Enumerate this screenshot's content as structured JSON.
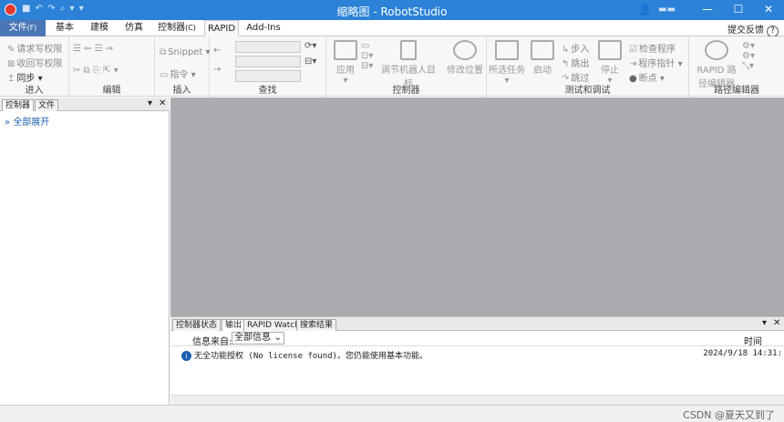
{
  "window": {
    "title": "缩略图 - RobotStudio",
    "user": "👤"
  },
  "tabs": [
    {
      "label": "文件",
      "key": "(F)"
    },
    {
      "label": "基本"
    },
    {
      "label": "建模"
    },
    {
      "label": "仿真"
    },
    {
      "label": "控制器",
      "key": "(C)"
    },
    {
      "label": "RAPID"
    },
    {
      "label": "Add-Ins"
    }
  ],
  "feedback": {
    "label": "提交反馈",
    "help": "?"
  },
  "ribbon": {
    "enter": {
      "label": "进入",
      "request": "请求写权限",
      "revoke": "收回写权限",
      "sync": "同步"
    },
    "edit": {
      "label": "编辑"
    },
    "insert": {
      "label": "插入",
      "snippet": "Snippet",
      "instruction": "指令"
    },
    "find": {
      "label": "查找"
    },
    "controller": {
      "label": "控制器",
      "apply": "应用",
      "adjust_targets": "调节机器人目标",
      "modify_position": "修改位置"
    },
    "test": {
      "label": "测试和调试",
      "select_tasks": "所选任务",
      "start": "启动",
      "step_in": "步入",
      "step_out": "跳出",
      "step_over": "跳过",
      "stop": "停止",
      "check_program": "检查程序",
      "program_pointer": "程序指针",
      "breakpoint": "断点"
    },
    "path": {
      "label": "路径编辑器",
      "rapid_path": "RAPID 路径编辑器"
    }
  },
  "left_panel": {
    "tabs": [
      "控制器",
      "文件"
    ],
    "expand_all": "全部展开"
  },
  "output": {
    "tabs": [
      "控制器状态",
      "输出",
      "RAPID Watch",
      "搜索结果"
    ],
    "filter_label": "信息来自:",
    "filter_value": "全部信息",
    "time_header": "时间",
    "message": "无全功能授权 (No license found)。您仍能使用基本功能。",
    "message_time": "2024/9/18 14:31:"
  },
  "watermark": "CSDN @夏天又到了"
}
